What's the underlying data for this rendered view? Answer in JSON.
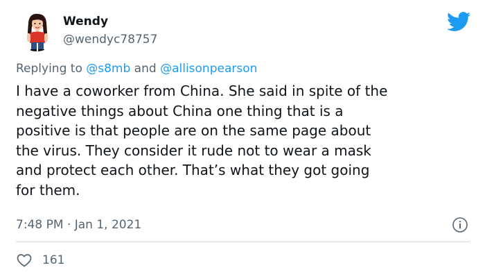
{
  "user": {
    "display_name": "Wendy",
    "handle": "@wendyc78757"
  },
  "reply": {
    "prefix": "Replying to ",
    "mention_1": "@s8mb",
    "connector": " and ",
    "mention_2": "@allisonpearson"
  },
  "tweet": {
    "text": "I have a coworker from China. She said in spite of the\nnegative things about China one thing that is a\npositive is that people are on the same page about\nthe virus.  They consider it rude not to wear a mask\nand protect each other. That’s what they got going\nfor them.",
    "timestamp": "7:48 PM · Jan 1, 2021"
  },
  "stats": {
    "likes": "161"
  },
  "icons": {
    "brand": "twitter-bird-icon",
    "info": "info-icon",
    "like": "heart-icon"
  },
  "colors": {
    "brand_blue": "#1d9bf0",
    "secondary_text": "#536471",
    "primary_text": "#0f1419",
    "divider": "#cfd9de"
  }
}
